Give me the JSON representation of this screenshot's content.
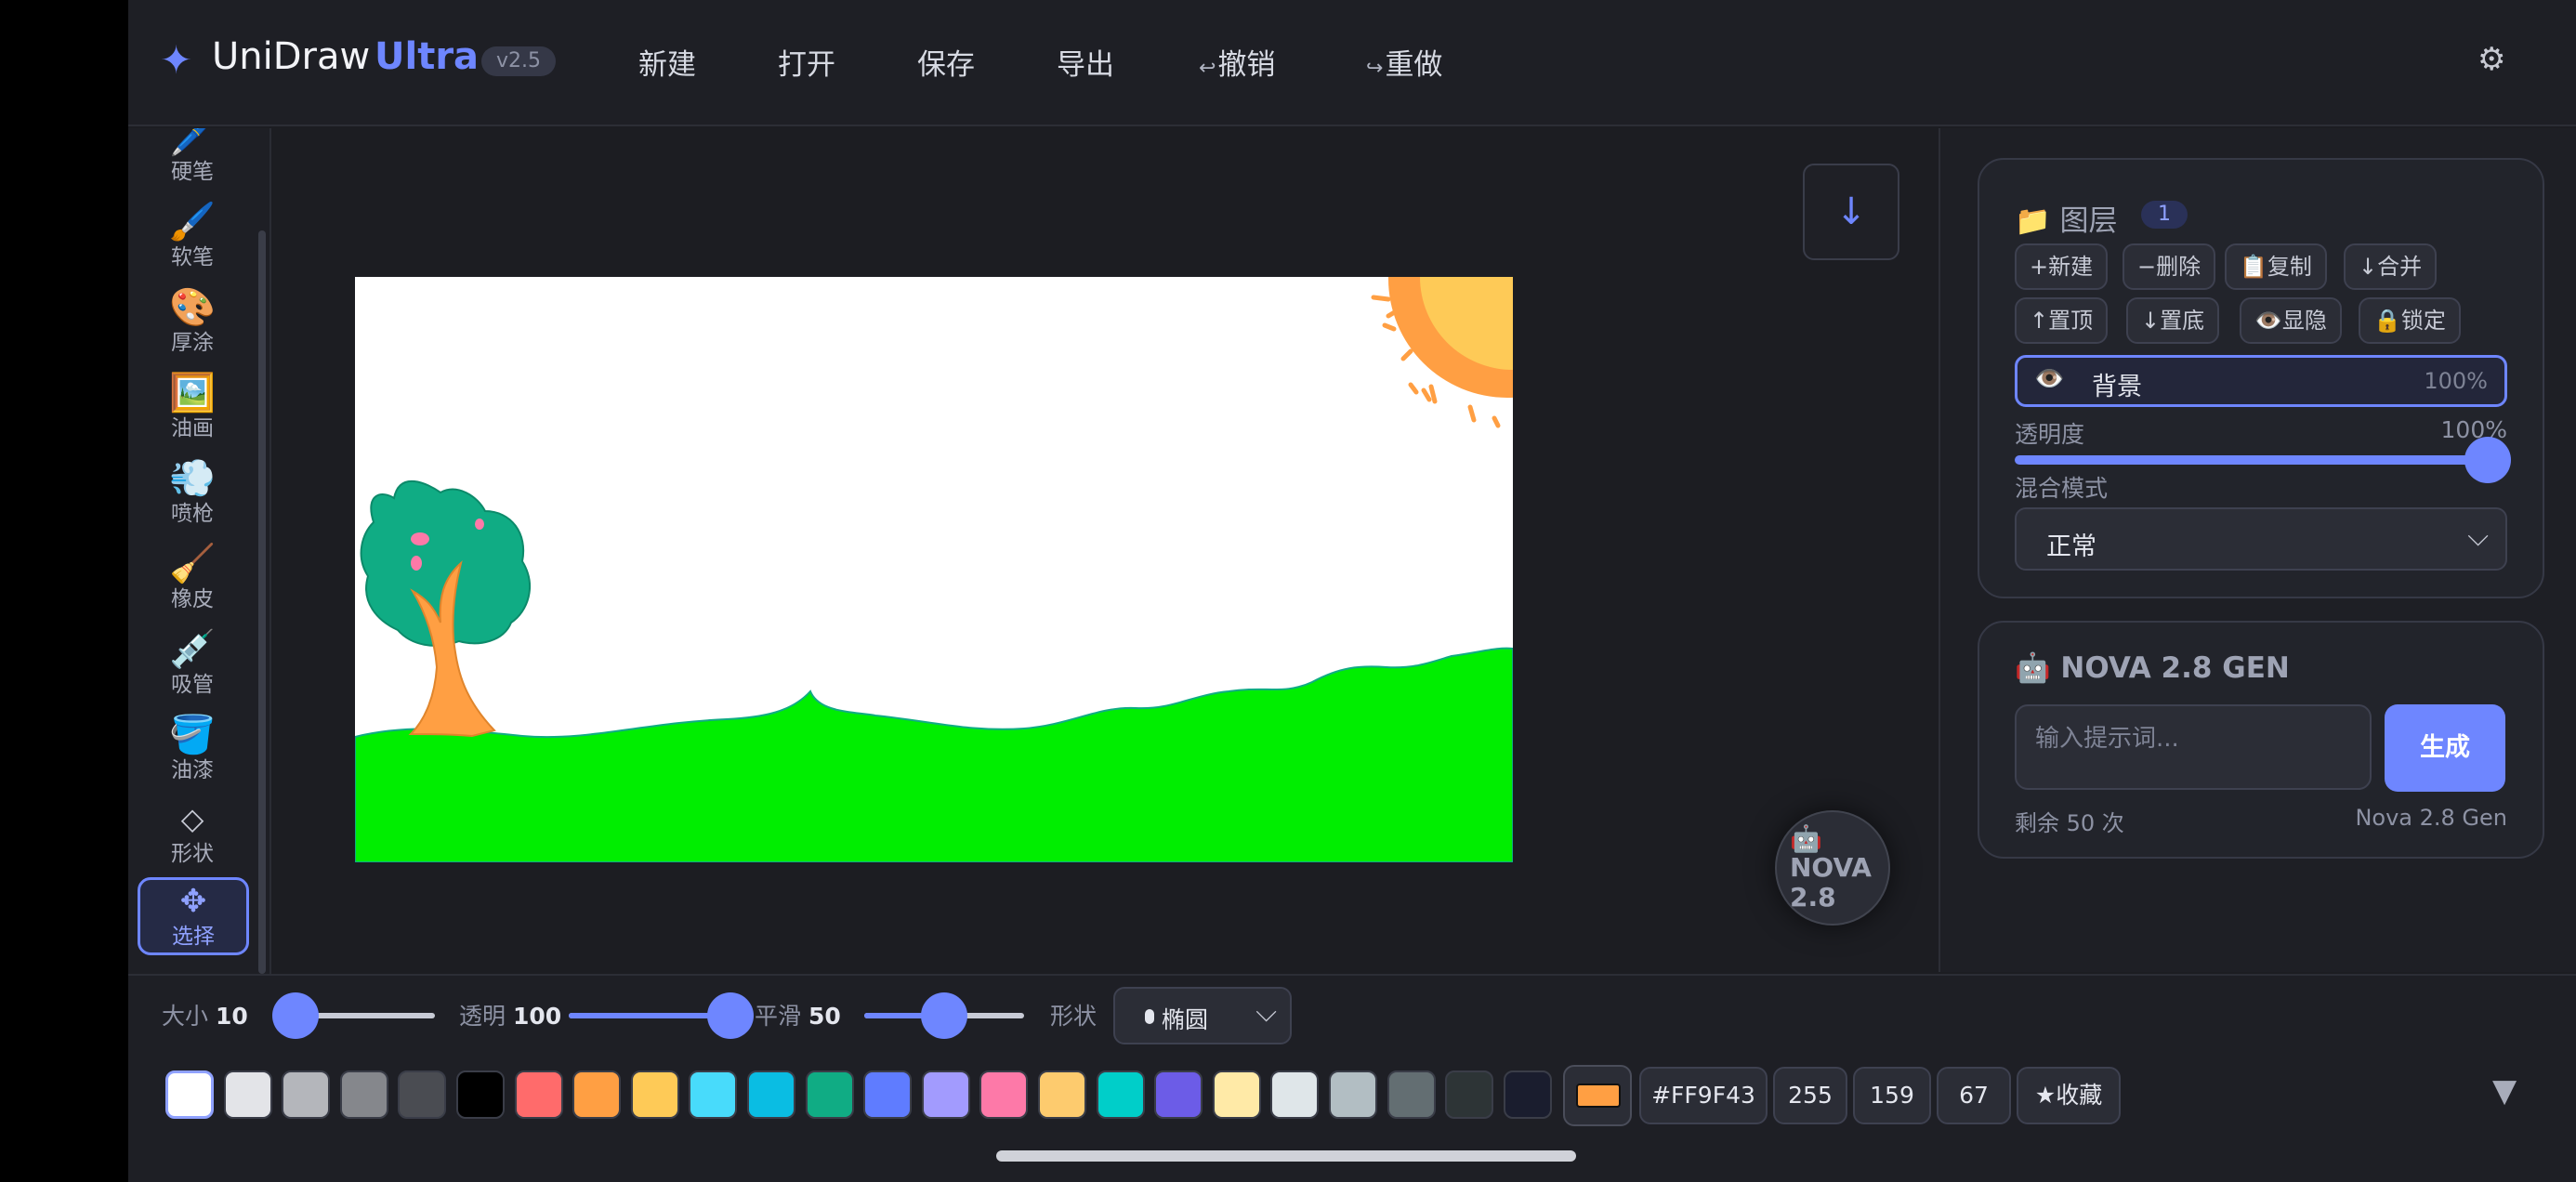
{
  "app": {
    "name": "UniDraw",
    "edition": "Ultra",
    "version": "v2.5"
  },
  "menu": {
    "new": "新建",
    "open": "打开",
    "save": "保存",
    "export": "导出",
    "undo_arrow": "↩",
    "undo": "撤销",
    "redo_arrow": "↪",
    "redo": "重做"
  },
  "tools": [
    {
      "icon": "🖊️",
      "label": "硬笔"
    },
    {
      "icon": "🖌️",
      "label": "软笔"
    },
    {
      "icon": "🎨",
      "label": "厚涂"
    },
    {
      "icon": "🖼️",
      "label": "油画"
    },
    {
      "icon": "💨",
      "label": "喷枪"
    },
    {
      "icon": "🧹",
      "label": "橡皮"
    },
    {
      "icon": "💉",
      "label": "吸管"
    },
    {
      "icon": "🪣",
      "label": "油漆"
    },
    {
      "icon": "◇",
      "label": "形状"
    },
    {
      "icon": "✥",
      "label": "选择",
      "active": true
    }
  ],
  "canvas": {
    "download_icon": "↓",
    "nova_fab": {
      "icon": "🤖",
      "text": "NOVA 2.8"
    }
  },
  "layers": {
    "title_icon": "📁",
    "title": "图层",
    "count": "1",
    "buttons": {
      "new": "+新建",
      "delete": "−删除",
      "copy": "📋复制",
      "merge": "↓合并",
      "top": "↑置顶",
      "bottom": "↓置底",
      "visibility": "👁️显隐",
      "lock": "🔒锁定"
    },
    "items": [
      {
        "eye": "👁️",
        "name": "背景",
        "opacity": "100%"
      }
    ],
    "opacity_label": "透明度",
    "opacity_value": "100%",
    "opacity_fraction": 1.0,
    "blend_label": "混合模式",
    "blend_value": "正常"
  },
  "generator": {
    "title_icon": "🤖",
    "title": "NOVA 2.8 GEN",
    "placeholder": "输入提示词...",
    "button": "生成",
    "remaining": "剩余 50 次",
    "model": "Nova 2.8 Gen"
  },
  "brush": {
    "size_label": "大小",
    "size_value": "10",
    "size_fraction": 0.0,
    "opacity_label": "透明",
    "opacity_value": "100",
    "opacity_fraction": 1.0,
    "smooth_label": "平滑",
    "smooth_value": "50",
    "smooth_fraction": 0.5,
    "shape_label": "形状",
    "shape_value": "椭圆"
  },
  "palette": [
    "#ffffff",
    "#e3e4e8",
    "#b4b6bb",
    "#85878c",
    "#4a4c52",
    "#000000",
    "#ff6b6b",
    "#ff9f43",
    "#feca57",
    "#48dbfb",
    "#0abde3",
    "#10ac84",
    "#5f7cff",
    "#a29bfe",
    "#fd79a8",
    "#fdcb6e",
    "#00cec9",
    "#6c5ce7",
    "#ffeaa7",
    "#dfe6e9",
    "#b2bec3",
    "#636e72",
    "#2d3436",
    "#1a1d2e"
  ],
  "color": {
    "current": "#FF9F43",
    "hex": "#FF9F43",
    "r": "255",
    "g": "159",
    "b": "67",
    "favorite": "★收藏"
  },
  "icons": {
    "logo": "logo-star-icon",
    "settings": "gear-icon",
    "collapse": "triangle-down-icon"
  }
}
